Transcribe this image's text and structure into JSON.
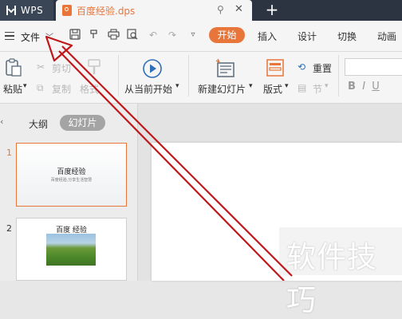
{
  "titlebar": {
    "app_label": "WPS",
    "doc_tab_label": "百度经验.dps",
    "new_tab": "+"
  },
  "menu": {
    "file_label": "文件",
    "tabs": [
      "开始",
      "插入",
      "设计",
      "切换",
      "动画"
    ]
  },
  "ribbon": {
    "paste_label": "粘贴",
    "cut_label": "剪切",
    "copy_label": "复制",
    "format_label": "格式",
    "play_label": "从当前开始",
    "new_slide_label": "新建幻灯片",
    "layout_label": "版式",
    "reset_label": "重置",
    "section_label": "节"
  },
  "pane": {
    "outline_tab": "大纲",
    "slides_tab": "幻灯片"
  },
  "thumbnails": [
    {
      "number": "1",
      "title": "百度经验",
      "subtitle": "百度经验,分享生活智慧"
    },
    {
      "number": "2",
      "title": "百度 经验"
    }
  ],
  "watermark": "软件技巧",
  "colors": {
    "accent": "#e8753a",
    "titlebar": "#2b3440",
    "annotation_arrow": "#c0181a"
  },
  "icons": [
    "wps-logo-icon",
    "dps-file-icon",
    "pin-icon",
    "close-icon",
    "plus-icon",
    "menu-icon",
    "chevron-down-icon",
    "save-icon",
    "format-painter-icon",
    "print-icon",
    "print-preview-icon",
    "undo-icon",
    "redo-icon",
    "dropdown-icon",
    "paste-icon",
    "cut-icon",
    "copy-icon",
    "play-icon",
    "new-slide-icon",
    "layout-icon",
    "reset-icon",
    "section-icon"
  ]
}
